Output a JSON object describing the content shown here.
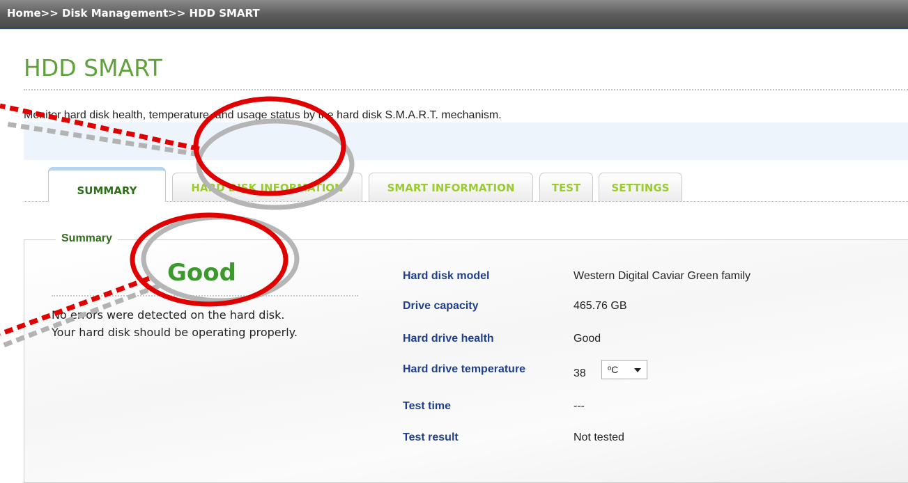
{
  "breadcrumb": "Home>> Disk Management>> HDD SMART",
  "page": {
    "title": "HDD SMART",
    "description": "Monitor hard disk health, temperature, and usage status by the hard disk S.M.A.R.T. mechanism."
  },
  "tabs": [
    {
      "label": "SUMMARY",
      "active": true
    },
    {
      "label": "HARD DISK INFORMATION",
      "active": false
    },
    {
      "label": "SMART INFORMATION",
      "active": false
    },
    {
      "label": "TEST",
      "active": false
    },
    {
      "label": "SETTINGS",
      "active": false
    }
  ],
  "summary": {
    "legend": "Summary",
    "status": "Good",
    "message_line1": "No errors were detected on the hard disk.",
    "message_line2": "Your hard disk should be operating properly.",
    "rows": [
      {
        "label": "Hard disk model",
        "value": "Western Digital Caviar Green family"
      },
      {
        "label": "Drive capacity",
        "value": "465.76 GB"
      },
      {
        "label": "Hard drive health",
        "value": "Good"
      },
      {
        "label": "Hard drive temperature",
        "value": "38"
      },
      {
        "label": "Test time",
        "value": "---"
      },
      {
        "label": "Test result",
        "value": "Not tested"
      }
    ],
    "temperature_unit": "ºC"
  },
  "colors": {
    "title_green": "#5fa13a",
    "label_blue": "#1f3f8a",
    "annotation_red": "#e00000",
    "annotation_gray": "#b3b3b3"
  }
}
